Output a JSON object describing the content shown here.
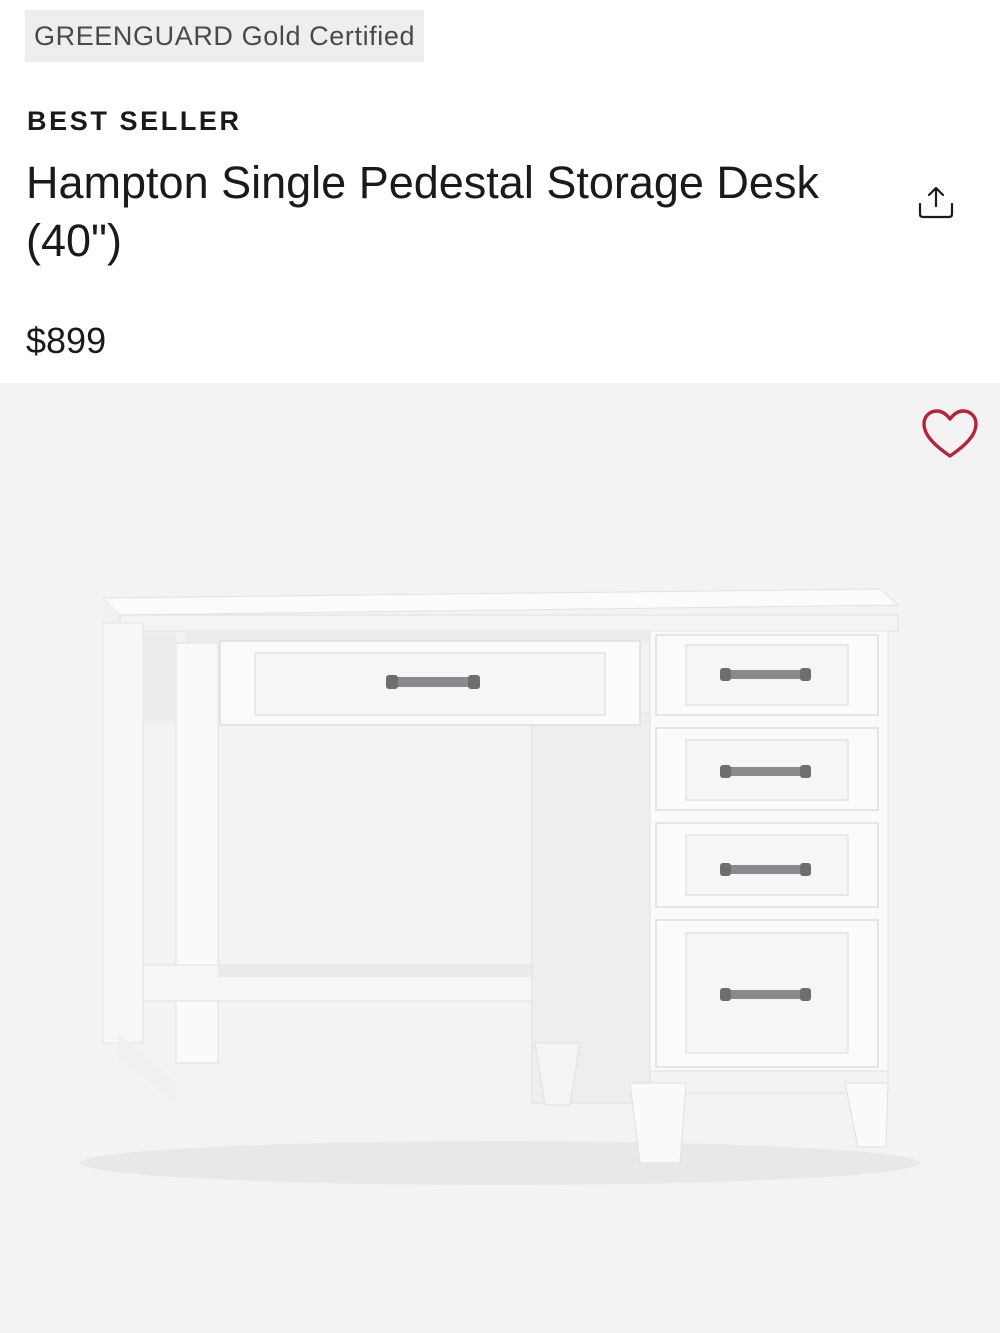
{
  "certification": "GREENGUARD Gold Certified",
  "badge": "BEST SELLER",
  "product": {
    "title": "Hampton Single Pedestal Storage Desk (40\")",
    "price": "$899"
  },
  "icons": {
    "share": "share-upload-icon",
    "wishlist": "heart-outline-icon"
  },
  "colors": {
    "wishlist_heart": "#b5243a",
    "image_background": "#f3f3f3",
    "badge_background": "#eeeeee"
  }
}
